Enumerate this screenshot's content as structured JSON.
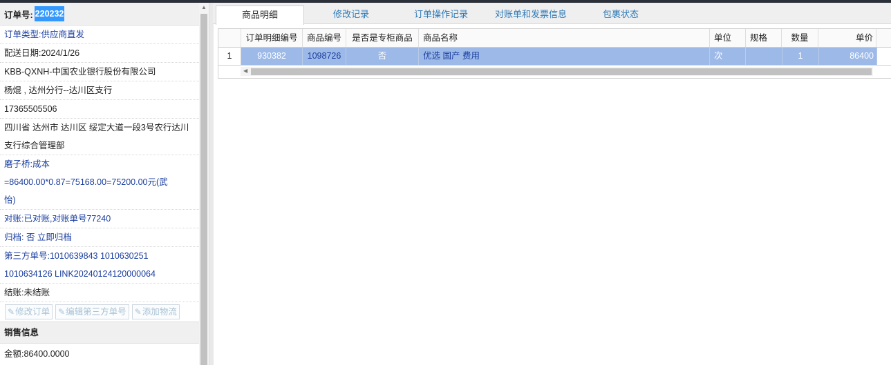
{
  "order": {
    "label": "订单号:",
    "number": "220232",
    "type": "订单类型:供应商直发",
    "delivery_date": "配送日期:2024/1/26",
    "company": "KBB-QXNH-中国农业银行股份有限公司",
    "contact": "杨焜 , 达州分行--达川区支行",
    "phone": "17365505506",
    "address_line1": "四川省 达州市 达川区 绥定大道一段3号农行达川",
    "address_line2": "支行综合管理部",
    "note_line1": "磨子桥:成本",
    "note_line2": "=86400.00*0.87=75168.00=75200.00元(武",
    "note_line3": "怡)",
    "reconcile": "对账:已对账,对账单号77240",
    "archive": "归档: 否 立即归档",
    "third_party_line1": "第三方单号:1010639843 1010630251",
    "third_party_line2": "1010634126 LINK20240124120000064",
    "settle": "结账:未结账"
  },
  "buttons": {
    "edit_order": "修改订单",
    "edit_third_party": "编辑第三方单号",
    "add_logistics": "添加物流"
  },
  "sales": {
    "title": "销售信息",
    "amount": "金额:86400.0000"
  },
  "tabs": [
    {
      "label": "商品明细",
      "active": true
    },
    {
      "label": "修改记录"
    },
    {
      "label": "订单操作记录"
    },
    {
      "label": "对账单和发票信息"
    },
    {
      "label": "包裹状态"
    }
  ],
  "grid": {
    "headers": {
      "detail_no": "订单明细编号",
      "product_no": "商品编号",
      "exclusive": "是否是专柜商品",
      "product_name": "商品名称",
      "unit": "单位",
      "spec": "规格",
      "qty": "数量",
      "price": "单价"
    },
    "rows": [
      {
        "index": "1",
        "detail_no": "930382",
        "product_no": "1098726",
        "exclusive": "否",
        "product_name": "优选 国产 费用",
        "unit": "次",
        "spec": "",
        "qty": "1",
        "price": "86400"
      }
    ]
  },
  "colors": {
    "accent": "#3399ff",
    "row_selected": "#9db9e8",
    "link_blue": "#1a3ea0",
    "tab_text": "#2d7ab8"
  }
}
